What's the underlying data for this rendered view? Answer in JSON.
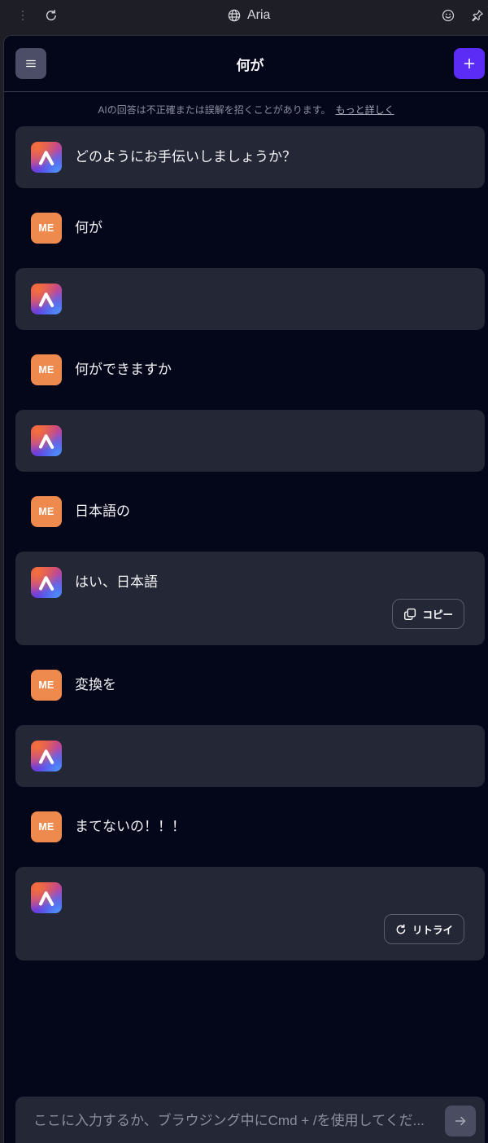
{
  "topbar": {
    "title": "Aria",
    "icons": {
      "drag": "drag-handle-icon",
      "reload": "reload-icon",
      "title": "globe-icon",
      "feedback": "smiley-icon",
      "pin": "pin-icon"
    }
  },
  "header": {
    "title": "何が",
    "menu_icon": "hamburger-menu-icon",
    "new_chat_icon": "plus-icon"
  },
  "disclaimer": {
    "text": "AIの回答は不正確または誤解を招くことがあります。",
    "link": "もっと詳しく"
  },
  "messages": [
    {
      "avatar_icon": "aria-logo-icon",
      "text": "どのようにお手伝いしましょうか？"
    },
    {
      "avatar_label": "ME",
      "text": "何が"
    },
    {
      "avatar_icon": "aria-logo-icon",
      "text": ""
    },
    {
      "avatar_label": "ME",
      "text": "何ができますか"
    },
    {
      "avatar_icon": "aria-logo-icon",
      "text": ""
    },
    {
      "avatar_label": "ME",
      "text": "日本語の"
    },
    {
      "avatar_icon": "aria-logo-icon",
      "text": "はい、日本語",
      "action": {
        "icon": "copy-icon",
        "label": "コピー"
      }
    },
    {
      "avatar_label": "ME",
      "text": "変換を"
    },
    {
      "avatar_icon": "aria-logo-icon",
      "text": ""
    },
    {
      "avatar_label": "ME",
      "text": "まてないの！！！"
    },
    {
      "avatar_icon": "aria-logo-icon",
      "text": "",
      "action": {
        "icon": "refresh-icon",
        "label": "リトライ"
      }
    }
  ],
  "composer": {
    "placeholder": "ここに入力するか、ブラウジング中にCmd + /を使用してくだ...",
    "send_icon": "arrow-right-icon"
  },
  "colors": {
    "topbar": "#1e1f26",
    "panel": "#04061a",
    "card": "#242735",
    "accent": "#5b2cf6",
    "user-avatar": "#ef8a4f",
    "button": "#4b4e66",
    "send-button": "#4a4d61",
    "muted-text": "#8c8f9e",
    "text": "#f2f2f5"
  }
}
